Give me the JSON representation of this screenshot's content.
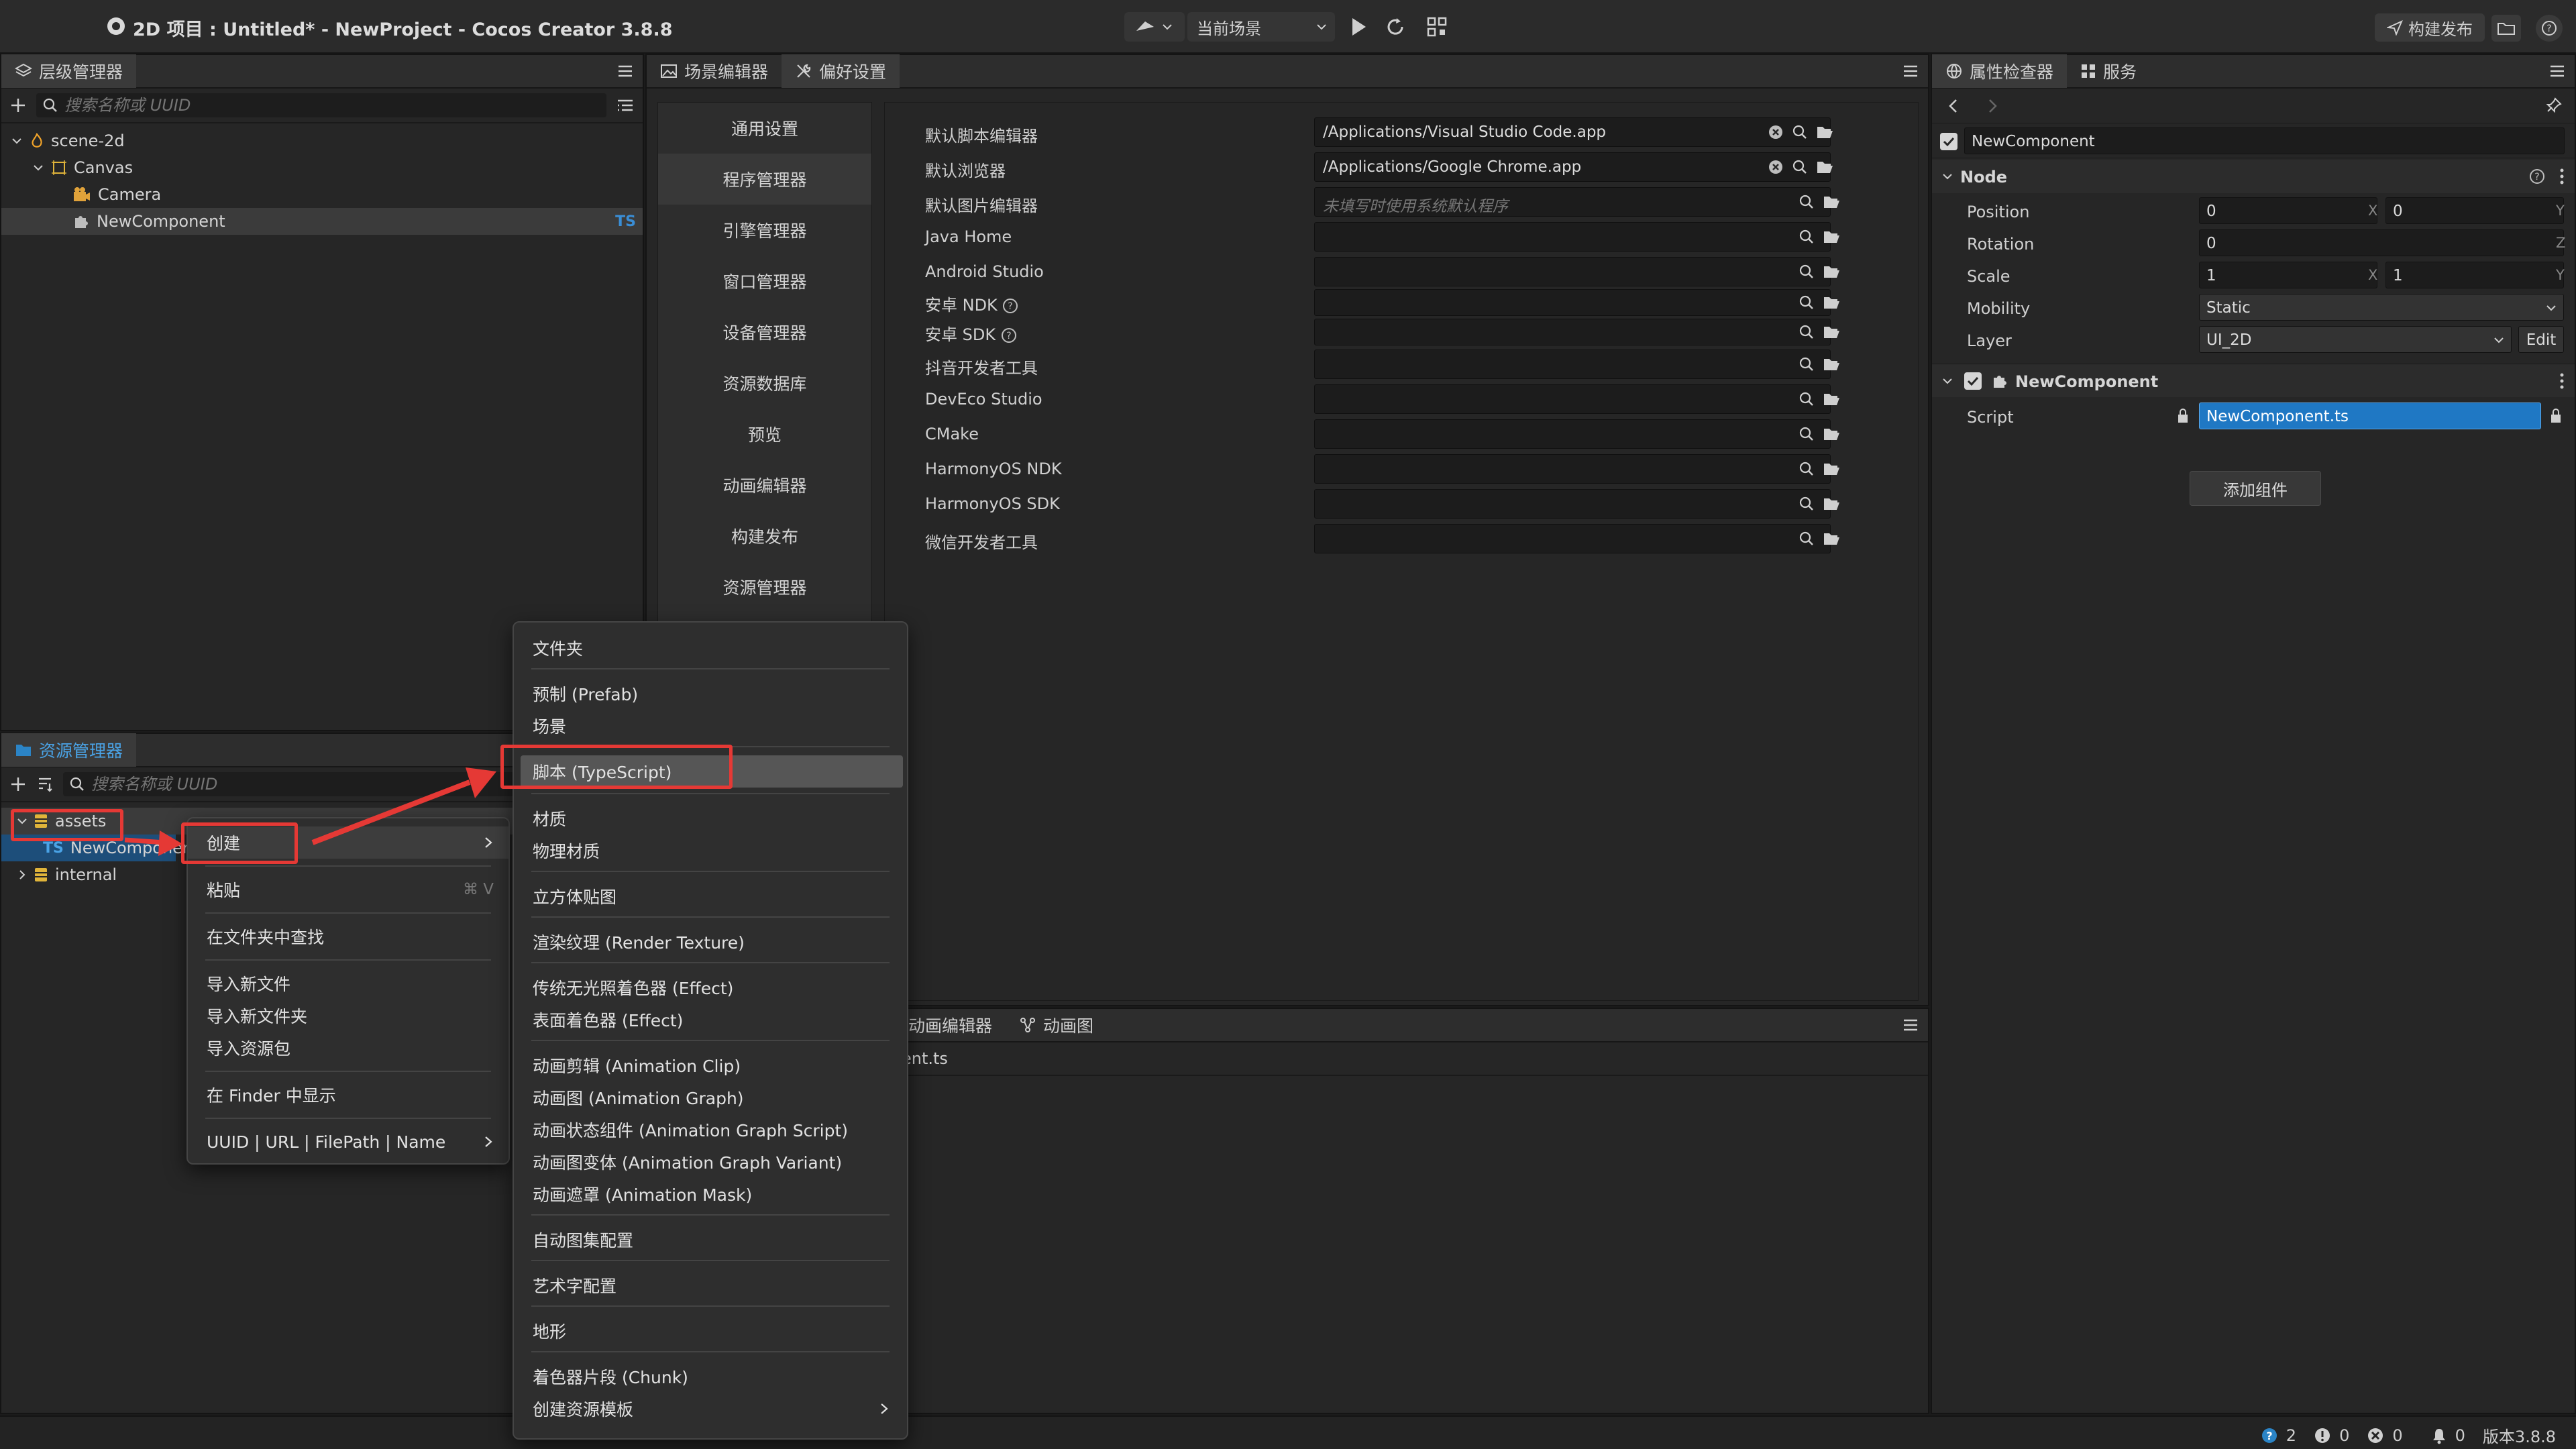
{
  "window": {
    "title": "2D 项目 : Untitled* - NewProject - Cocos Creator 3.8.8",
    "scene_selector": "当前场景",
    "build_button": "构建发布"
  },
  "hierarchy": {
    "tab": "层级管理器",
    "search_placeholder": "搜索名称或 UUID",
    "nodes": [
      "scene-2d",
      "Canvas",
      "Camera",
      "NewComponent"
    ],
    "ts_badge": "TS"
  },
  "center_tabs": [
    "场景编辑器",
    "偏好设置"
  ],
  "preferences": {
    "nav": [
      "通用设置",
      "程序管理器",
      "引擎管理器",
      "窗口管理器",
      "设备管理器",
      "资源数据库",
      "预览",
      "动画编辑器",
      "构建发布",
      "资源管理器"
    ],
    "rows": [
      {
        "label": "默认脚本编辑器",
        "value": "/Applications/Visual Studio Code.app",
        "placeholder": ""
      },
      {
        "label": "默认浏览器",
        "value": "/Applications/Google Chrome.app",
        "placeholder": ""
      },
      {
        "label": "默认图片编辑器",
        "value": "",
        "placeholder": "未填写时使用系统默认程序"
      },
      {
        "label": "Java Home",
        "value": "",
        "placeholder": ""
      },
      {
        "label": "Android Studio",
        "value": "",
        "placeholder": ""
      },
      {
        "label": "安卓 NDK",
        "value": "",
        "placeholder": ""
      },
      {
        "label": "安卓 SDK",
        "value": "",
        "placeholder": ""
      },
      {
        "label": "抖音开发者工具",
        "value": "",
        "placeholder": ""
      },
      {
        "label": "DevEco Studio",
        "value": "",
        "placeholder": ""
      },
      {
        "label": "CMake",
        "value": "",
        "placeholder": ""
      },
      {
        "label": "HarmonyOS NDK",
        "value": "",
        "placeholder": ""
      },
      {
        "label": "HarmonyOS SDK",
        "value": "",
        "placeholder": ""
      },
      {
        "label": "微信开发者工具",
        "value": "",
        "placeholder": ""
      }
    ]
  },
  "bottom_tabs": [
    "动画编辑器",
    "动画图"
  ],
  "bottom_content": "ent.ts",
  "assets": {
    "tab": "资源管理器",
    "search_placeholder": "搜索名称或 UUID",
    "items": [
      "assets",
      "NewComponent",
      "internal"
    ]
  },
  "inspector": {
    "tabs": [
      "属性检查器",
      "服务"
    ],
    "node_name": "NewComponent",
    "node_section": "Node",
    "position_label": "Position",
    "position_x": "0",
    "position_y": "0",
    "rotation_label": "Rotation",
    "rotation_z": "0",
    "scale_label": "Scale",
    "scale_x": "1",
    "scale_y": "1",
    "mobility_label": "Mobility",
    "mobility_value": "Static",
    "layer_label": "Layer",
    "layer_value": "UI_2D",
    "edit_label": "Edit",
    "component_name": "NewComponent",
    "script_label": "Script",
    "script_value": "NewComponent.ts",
    "add_component": "添加组件",
    "axes": {
      "x": "X",
      "y": "Y",
      "z": "Z"
    }
  },
  "context_menu": {
    "items": [
      {
        "label": "创建",
        "shortcut": ""
      },
      {
        "label": "粘贴",
        "shortcut": "⌘ V"
      },
      {
        "label": "在文件夹中查找",
        "shortcut": ""
      },
      {
        "label": "导入新文件",
        "shortcut": ""
      },
      {
        "label": "导入新文件夹",
        "shortcut": ""
      },
      {
        "label": "导入资源包",
        "shortcut": ""
      },
      {
        "label": "在 Finder 中显示",
        "shortcut": ""
      },
      {
        "label": "UUID | URL | FilePath | Name",
        "shortcut": ""
      }
    ]
  },
  "create_submenu": {
    "items": [
      "文件夹",
      "预制 (Prefab)",
      "场景",
      "脚本 (TypeScript)",
      "材质",
      "物理材质",
      "立方体贴图",
      "渲染纹理 (Render Texture)",
      "传统无光照着色器 (Effect)",
      "表面着色器 (Effect)",
      "动画剪辑 (Animation Clip)",
      "动画图 (Animation Graph)",
      "动画状态组件 (Animation Graph Script)",
      "动画图变体 (Animation Graph Variant)",
      "动画遮罩 (Animation Mask)",
      "自动图集配置",
      "艺术字配置",
      "地形",
      "着色器片段 (Chunk)",
      "创建资源模板"
    ]
  },
  "status": {
    "info": "2",
    "warn": "0",
    "error": "0",
    "bell": "0",
    "version": "版本3.8.8"
  },
  "colors": {
    "accent": "#2b84c6",
    "highlight": "#e53935",
    "script_field": "#1f78c4"
  }
}
